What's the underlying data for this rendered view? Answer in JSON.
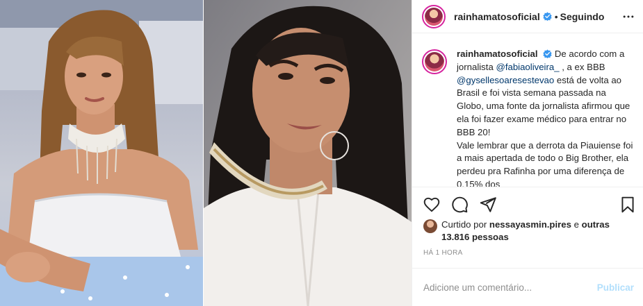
{
  "post": {
    "username": "rainhamatosoficial",
    "follow_state": "Seguindo",
    "separator": "•",
    "caption": {
      "username": "rainhamatosoficial",
      "p1": "De acordo com a jornalista",
      "mention1": "@fabiaoliveira_",
      "p2": ", a ex BBB",
      "mention2": "@gysellesoaresestevao",
      "p3": "está de volta ao Brasil e foi vista semana passada na Globo, uma fonte da jornalista afirmou que ela foi fazer exame médico para entrar no BBB 20!",
      "p4": "Vale lembrar que a derrota da Piauiense foi a mais apertada de todo o Big Brother, ela perdeu pra Rafinha",
      "p5": "por uma diferença de 0,15% dos"
    },
    "likes": {
      "prefix": "Curtido por",
      "user": "nessayasmin.pires",
      "middle": "e",
      "count_text": "outras 13.816 pessoas"
    },
    "timestamp": "HÁ 1 HORA",
    "comment": {
      "placeholder": "Adicione um comentário...",
      "publish_label": "Publicar"
    }
  },
  "icons": {
    "verified": "verified-badge-icon",
    "more": "more-options-icon",
    "like": "heart-icon",
    "comment": "comment-bubble-icon",
    "share": "paper-plane-icon",
    "save": "bookmark-icon"
  },
  "colors": {
    "accent_blue": "#0095f6",
    "mention": "#00376b",
    "muted": "#8e8e8e",
    "publish_disabled": "#b2dffc"
  }
}
